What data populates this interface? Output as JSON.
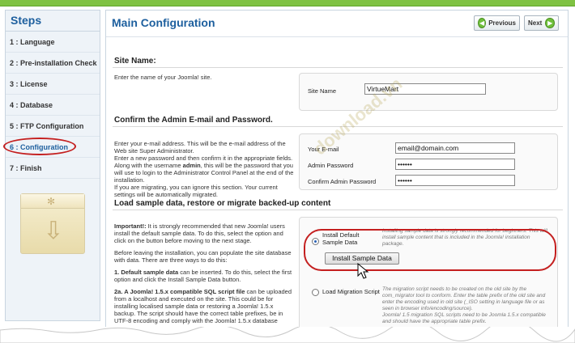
{
  "sidebar": {
    "title": "Steps",
    "steps": [
      {
        "label": "1 : Language"
      },
      {
        "label": "2 : Pre-installation Check"
      },
      {
        "label": "3 : License"
      },
      {
        "label": "4 : Database"
      },
      {
        "label": "5 : FTP Configuration"
      },
      {
        "label": "6 : Configuration"
      },
      {
        "label": "7 : Finish"
      }
    ],
    "active_index": 5
  },
  "header": {
    "title": "Main Configuration",
    "previous_label": "Previous",
    "next_label": "Next"
  },
  "site_name": {
    "title": "Site Name:",
    "description": "Enter the name of your Joomla! site.",
    "field_label": "Site Name",
    "field_value": "VirtueMart"
  },
  "admin": {
    "title": "Confirm the Admin E-mail and Password.",
    "description_1": "Enter your e-mail address. This will be the e-mail address of the Web site Super Administrator.",
    "description_2_a": "Enter a new password and then confirm it in the appropriate fields. Along with the username",
    "description_2_bold": "admin",
    "description_2_b": ", this will be the password that you will use to login to the Administrator Control Panel at the end of the installation.",
    "description_3": "If you are migrating, you can ignore this section. Your current settings will be automatically migrated.",
    "email_label": "Your E-mail",
    "email_value": "email@domain.com",
    "password_label": "Admin Password",
    "password_value": "••••••",
    "confirm_label": "Confirm Admin Password",
    "confirm_value": "••••••"
  },
  "sample": {
    "title": "Load sample data, restore or migrate backed-up content",
    "important_bold": "Important!:",
    "important_text": " It is strongly recommended that new Joomla! users install the default sample data. To do this, select the option and click on the button before moving to the next stage.",
    "before_text": "Before leaving the installation, you can populate the site database with data. There are three ways to do this:",
    "option1_bold": "1. Default sample data",
    "option1_text": " can be inserted. To do this, select the first option and click the Install Sample Data button.",
    "option2_bold": "2a. A Joomla! 1.5.x compatible SQL script file",
    "option2_text": " can be uploaded from a localhost and executed on the site. This could be for installing localised sample data or restoring a Joomla! 1.5.x backup. The script should have the correct table prefixes, be in UTF-8 encoding and comply with the Joomla! 1.5.x database",
    "radio1_label": "Install Default Sample Data",
    "radio1_note": "Installing sample data is strongly recommended for beginners. This will install sample content that is included in the Joomla! installation package.",
    "install_button": "Install Sample Data",
    "radio2_label": "Load Migration Script",
    "radio2_note": "The migration script needs to be created on the old site by the com_migrator tool to conform. Enter the table prefix of the old site and enter the encoding used in old site (_ISO setting in language file or as seen in browser info/encoding/source).",
    "radio2_note2": "Joomla! 1.5 migration SQL scripts need to be Joomla 1.5.x compatible and should have the appropriate table prefix."
  },
  "watermark": "download.vn",
  "colors": {
    "accent_blue": "#1d5f9e",
    "highlight_red": "#c41f1f",
    "top_green": "#7fc243"
  }
}
